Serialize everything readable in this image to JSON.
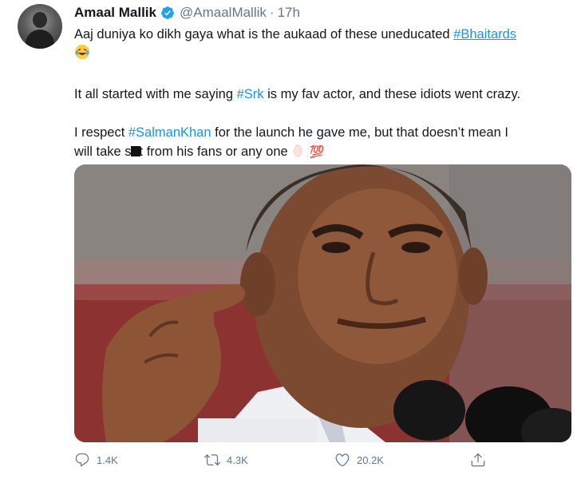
{
  "tweet": {
    "author_name": "Amaal Mallik",
    "handle": "@AmaalMallik",
    "separator": "·",
    "time": "17h",
    "line1_prefix": "Aaj duniya ko dikh gaya what is the aukaad of these uneducated ",
    "hashtag_bhaitards": "#Bhaitards",
    "line2_prefix": "It all started with me saying ",
    "hashtag_srk": "#Srk",
    "line2_suffix": " is my fav actor, and these idiots went crazy.",
    "line3_prefix": "I respect ",
    "hashtag_salman": "#SalmanKhan",
    "line3_suffix": " for the launch he gave me, but that doesn’t mean I",
    "line4_a": "will take s",
    "line4_b": "t from his fans or any one",
    "emoji_100": "💯"
  },
  "icons": {
    "avatar": "avatar",
    "verified": "verified-badge-icon",
    "laugh": "laughing-emoji-icon",
    "hand": "raised-hand-emoji-icon",
    "reply": "reply-icon",
    "retweet": "retweet-icon",
    "like": "heart-icon",
    "share": "share-icon"
  },
  "colors": {
    "link": "#1b95e0",
    "secondary": "#657786",
    "verified": "#1da1f2"
  },
  "actions": {
    "replies": "1.4K",
    "retweets": "4.3K",
    "likes": "20.2K"
  }
}
